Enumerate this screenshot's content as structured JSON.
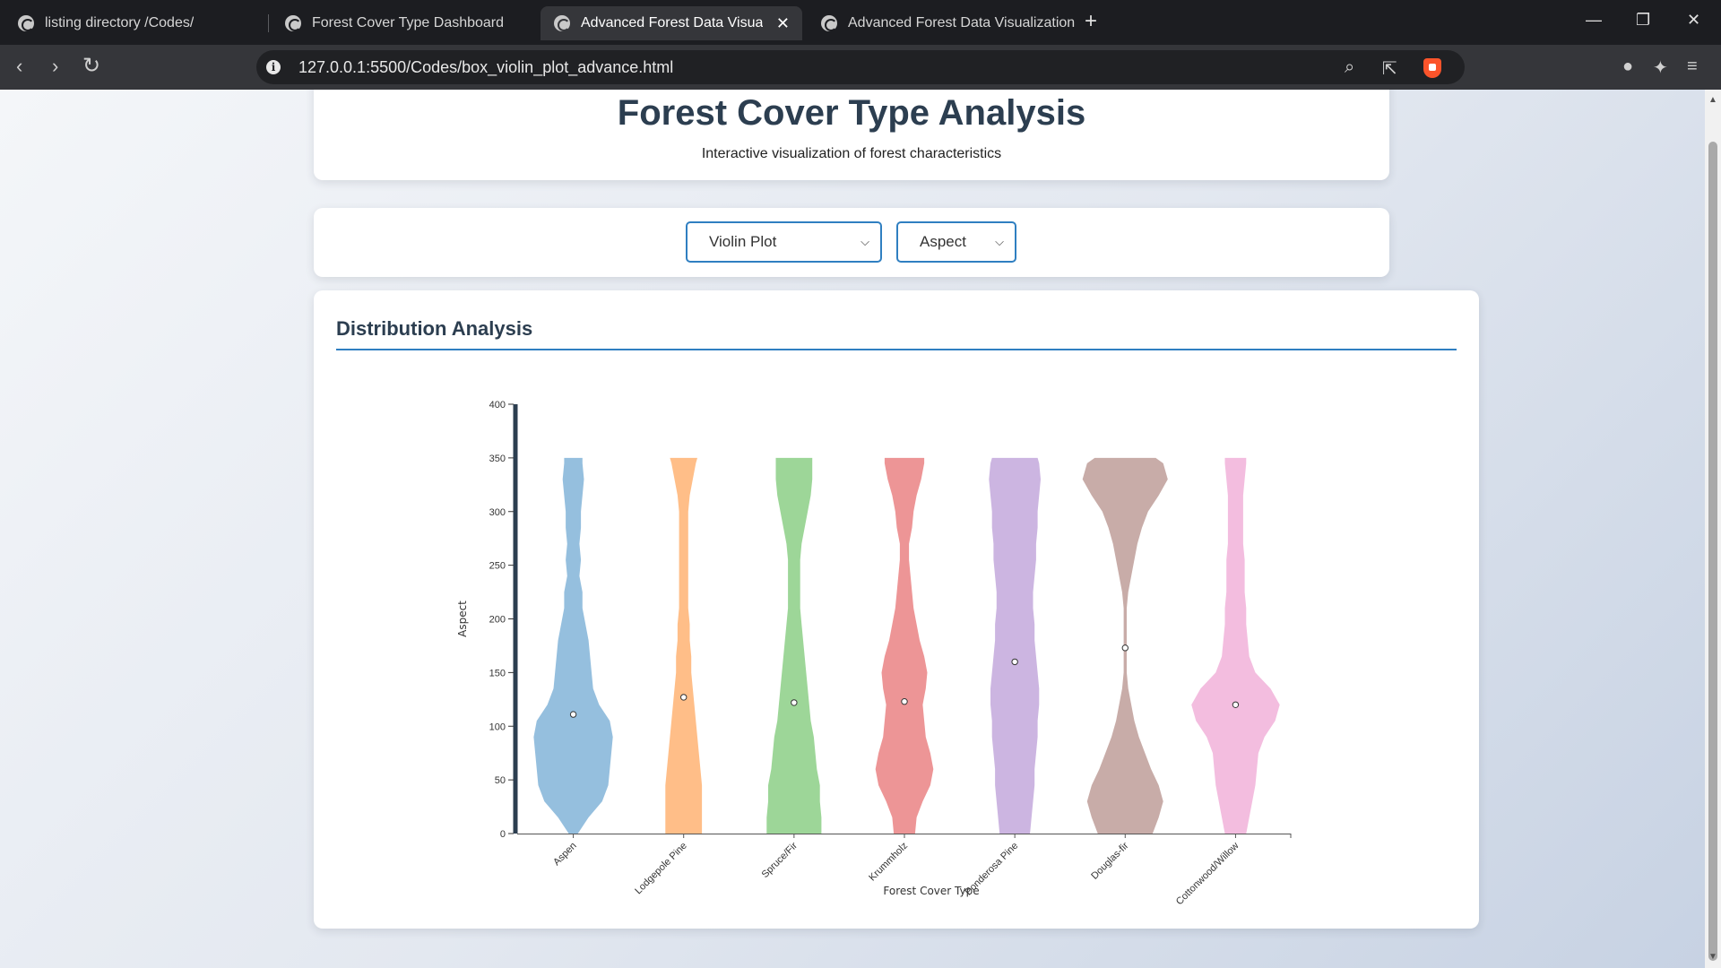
{
  "browser": {
    "tabs": [
      {
        "title": "listing directory /Codes/"
      },
      {
        "title": "Forest Cover Type Dashboard"
      },
      {
        "title": "Advanced Forest Data Visualiza"
      },
      {
        "title": "Advanced Forest Data Visualization"
      }
    ],
    "url": "127.0.0.1:5500/Codes/box_violin_plot_advance.html"
  },
  "header": {
    "title": "Forest Cover Type Analysis",
    "subtitle": "Interactive visualization of forest characteristics"
  },
  "controls": {
    "plot_type": "Violin Plot",
    "feature": "Aspect"
  },
  "panel": {
    "title": "Distribution Analysis"
  },
  "chart_data": {
    "type": "violin",
    "xlabel": "Forest Cover Type",
    "ylabel": "Aspect",
    "ylim": [
      0,
      400
    ],
    "yticks": [
      0,
      50,
      100,
      150,
      200,
      250,
      300,
      350,
      400
    ],
    "categories": [
      "Aspen",
      "Lodgepole Pine",
      "Spruce/Fir",
      "Krummholz",
      "Ponderosa Pine",
      "Douglas-fir",
      "Cottonwood/Willow"
    ],
    "colors": [
      "#8fbcdc",
      "#ffbb82",
      "#98d492",
      "#ec8f90",
      "#c9b1df",
      "#c5a8a3",
      "#f2b9dd"
    ],
    "medians": [
      111,
      127,
      122,
      123,
      160,
      173,
      120
    ],
    "violin_range": [
      0,
      350
    ],
    "density_profiles": {
      "aspect_values": [
        0,
        15,
        30,
        45,
        60,
        75,
        90,
        105,
        120,
        135,
        150,
        165,
        180,
        195,
        210,
        225,
        240,
        255,
        270,
        285,
        300,
        315,
        330,
        345,
        350
      ],
      "Aspen": [
        3,
        10,
        19,
        23,
        24,
        25,
        26,
        24,
        17,
        13,
        12,
        11,
        10,
        8,
        6,
        6,
        4,
        5,
        4,
        5,
        5,
        6,
        7,
        6,
        6
      ],
      "Lodgepole Pine": [
        12,
        12,
        12,
        12,
        11,
        10,
        9,
        8,
        7,
        6,
        5,
        5,
        4,
        4,
        3,
        3,
        3,
        3,
        3,
        3,
        3,
        4,
        6,
        8,
        9
      ],
      "Spruce/Fir": [
        18,
        18,
        17,
        17,
        15,
        14,
        13,
        11,
        10,
        9,
        8,
        7,
        6,
        5,
        4,
        4,
        4,
        4,
        5,
        7,
        9,
        11,
        12,
        12,
        12
      ],
      "Krummholz": [
        7,
        8,
        12,
        17,
        19,
        17,
        14,
        13,
        12,
        14,
        15,
        13,
        10,
        8,
        6,
        5,
        4,
        3,
        3,
        5,
        6,
        8,
        11,
        13,
        13
      ],
      "Ponderosa Pine": [
        10,
        11,
        12,
        13,
        13,
        14,
        15,
        15,
        16,
        16,
        15,
        14,
        13,
        13,
        12,
        12,
        13,
        14,
        14,
        15,
        15,
        16,
        17,
        16,
        15
      ],
      "Douglas-fir": [
        18,
        22,
        25,
        22,
        17,
        13,
        9,
        6,
        4,
        2,
        1,
        1,
        1,
        1,
        1,
        2,
        4,
        6,
        8,
        11,
        15,
        22,
        28,
        25,
        20
      ],
      "Cottonwood/Willow": [
        7,
        9,
        11,
        13,
        14,
        15,
        19,
        26,
        29,
        23,
        13,
        9,
        8,
        7,
        7,
        6,
        6,
        6,
        5,
        5,
        5,
        5,
        6,
        7,
        7
      ]
    }
  }
}
